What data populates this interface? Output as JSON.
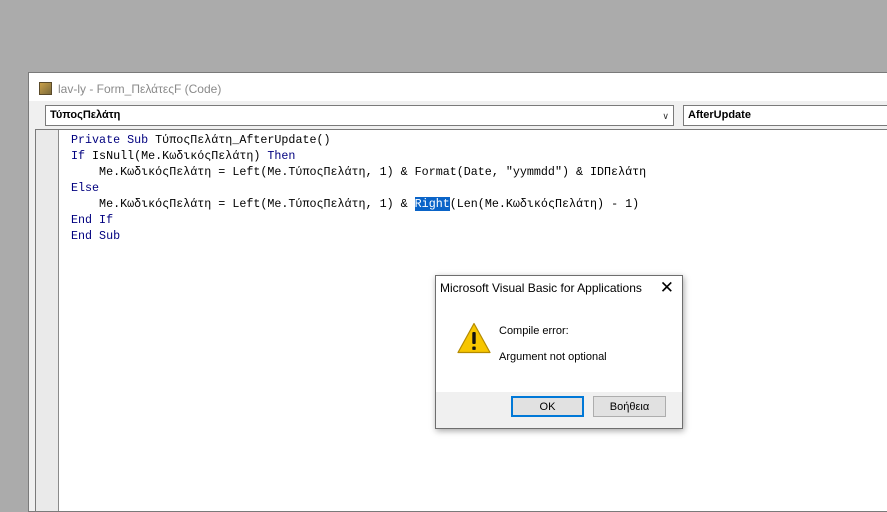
{
  "window": {
    "title": "lav-ly - Form_ΠελάτεςF (Code)",
    "object_combo": "ΤύποςΠελάτη",
    "procedure_combo": "AfterUpdate"
  },
  "code": {
    "line1_kw": "Private Sub",
    "line1_rest": " ΤύποςΠελάτη_AfterUpdate()",
    "line2_kw1": "If",
    "line2_mid": " IsNull(Me.ΚωδικόςΠελάτη) ",
    "line2_kw2": "Then",
    "line3": "    Me.ΚωδικόςΠελάτη = Left(Me.ΤύποςΠελάτη, 1) & Format(Date, \"yymmdd\") & IDΠελάτη",
    "line4_kw": "Else",
    "line5_pre": "    Me.ΚωδικόςΠελάτη = Left(Me.ΤύποςΠελάτη, 1) & ",
    "line5_sel": "Right",
    "line5_post": "(Len(Me.ΚωδικόςΠελάτη) - 1)",
    "line6_kw": "End If",
    "line7_kw": "End Sub"
  },
  "dialog": {
    "title": "Microsoft Visual Basic for Applications",
    "close_glyph": "✕",
    "message_line1": "Compile error:",
    "message_line2": "Argument not optional",
    "ok_label": "OK",
    "help_label": "Βοήθεια",
    "icon": "warning-icon"
  },
  "colors": {
    "keyword": "#00007f",
    "selection": "#0a64c8",
    "default_button_border": "#0078d7"
  }
}
